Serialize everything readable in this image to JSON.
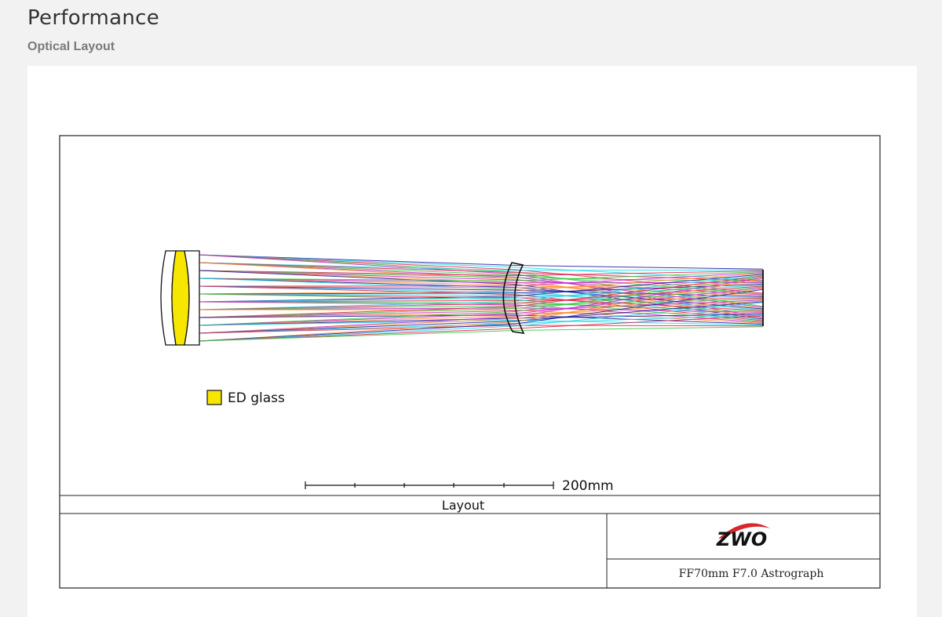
{
  "header": {
    "title": "Performance",
    "subtitle": "Optical Layout"
  },
  "diagram": {
    "legend": {
      "label": "ED glass",
      "color": "#f7e600"
    },
    "scale_bar": {
      "label": "200mm"
    },
    "caption": "Layout",
    "title_block": {
      "logo_text": "ZWO",
      "logo_accent": "#d8262c",
      "model": "FF70mm F7.0 Astrograph"
    },
    "ray_colors": [
      "#1a1aa0",
      "#19d8e6",
      "#e0204a",
      "#32c840",
      "#c828c8",
      "#ff8c28"
    ]
  }
}
